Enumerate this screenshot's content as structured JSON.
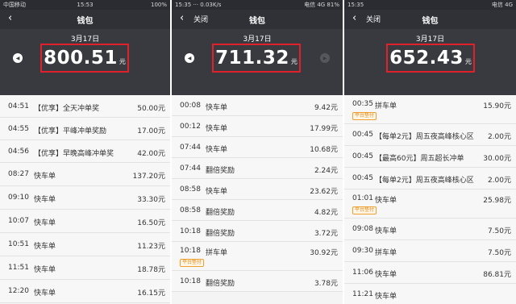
{
  "panels": [
    {
      "status": {
        "left": "中国移动",
        "center": "15:53",
        "right": "100%"
      },
      "nav": {
        "back": "‹",
        "close": "",
        "title": "钱包"
      },
      "header": {
        "date": "3月17日",
        "amount": "800.51",
        "unit": "元",
        "prev_icon": "◀",
        "next_icon": ""
      },
      "rows": [
        {
          "time": "04:51",
          "name": "【优享】全天冲单奖",
          "value": "50.00元",
          "tag": ""
        },
        {
          "time": "04:55",
          "name": "【优享】平峰冲单奖励",
          "value": "17.00元",
          "tag": ""
        },
        {
          "time": "04:56",
          "name": "【优享】早晚高峰冲单奖",
          "value": "42.00元",
          "tag": ""
        },
        {
          "time": "08:27",
          "name": "快车单",
          "value": "137.20元",
          "tag": ""
        },
        {
          "time": "09:10",
          "name": "快车单",
          "value": "33.30元",
          "tag": ""
        },
        {
          "time": "10:07",
          "name": "快车单",
          "value": "16.50元",
          "tag": ""
        },
        {
          "time": "10:51",
          "name": "快车单",
          "value": "11.23元",
          "tag": ""
        },
        {
          "time": "11:51",
          "name": "快车单",
          "value": "18.78元",
          "tag": ""
        },
        {
          "time": "12:20",
          "name": "快车单",
          "value": "16.15元",
          "tag": ""
        }
      ]
    },
    {
      "status": {
        "left": "15:35 ··· 0.03K/s",
        "center": "",
        "right": "电信 4G 81%"
      },
      "nav": {
        "back": "‹",
        "close": "关闭",
        "title": "钱包"
      },
      "header": {
        "date": "3月17日",
        "amount": "711.32",
        "unit": "元",
        "prev_icon": "◀",
        "next_icon": "▶"
      },
      "rows": [
        {
          "time": "00:08",
          "name": "快车单",
          "value": "9.42元",
          "tag": ""
        },
        {
          "time": "00:12",
          "name": "快车单",
          "value": "17.99元",
          "tag": ""
        },
        {
          "time": "07:44",
          "name": "快车单",
          "value": "10.68元",
          "tag": ""
        },
        {
          "time": "07:44",
          "name": "翻倍奖励",
          "value": "2.24元",
          "tag": ""
        },
        {
          "time": "08:58",
          "name": "快车单",
          "value": "23.62元",
          "tag": ""
        },
        {
          "time": "08:58",
          "name": "翻倍奖励",
          "value": "4.82元",
          "tag": ""
        },
        {
          "time": "10:18",
          "name": "翻倍奖励",
          "value": "3.72元",
          "tag": ""
        },
        {
          "time": "10:18",
          "name": "拼车单",
          "value": "30.92元",
          "tag": "平台垫付"
        },
        {
          "time": "10:18",
          "name": "翻倍奖励",
          "value": "3.78元",
          "tag": ""
        }
      ]
    },
    {
      "status": {
        "left": "15:35",
        "center": "",
        "right": "电信 4G"
      },
      "nav": {
        "back": "‹",
        "close": "关闭",
        "title": "钱包"
      },
      "header": {
        "date": "3月17日",
        "amount": "652.43",
        "unit": "元",
        "prev_icon": "◀",
        "next_icon": ""
      },
      "rows": [
        {
          "time": "00:35",
          "name": "拼车单",
          "value": "15.90元",
          "tag": "平台垫付"
        },
        {
          "time": "00:45",
          "name": "【每单2元】周五夜高峰核心区",
          "value": "2.00元",
          "tag": ""
        },
        {
          "time": "00:45",
          "name": "【最高60元】周五超长冲单",
          "value": "30.00元",
          "tag": ""
        },
        {
          "time": "00:45",
          "name": "【每单2元】周五夜高峰核心区",
          "value": "2.00元",
          "tag": ""
        },
        {
          "time": "01:01",
          "name": "快车单",
          "value": "25.98元",
          "tag": "平台垫付"
        },
        {
          "time": "09:08",
          "name": "快车单",
          "value": "7.50元",
          "tag": ""
        },
        {
          "time": "09:30",
          "name": "拼车单",
          "value": "7.50元",
          "tag": ""
        },
        {
          "time": "11:06",
          "name": "快车单",
          "value": "86.81元",
          "tag": ""
        },
        {
          "time": "11:21",
          "name": "快车单",
          "value": "",
          "tag": ""
        }
      ]
    }
  ]
}
